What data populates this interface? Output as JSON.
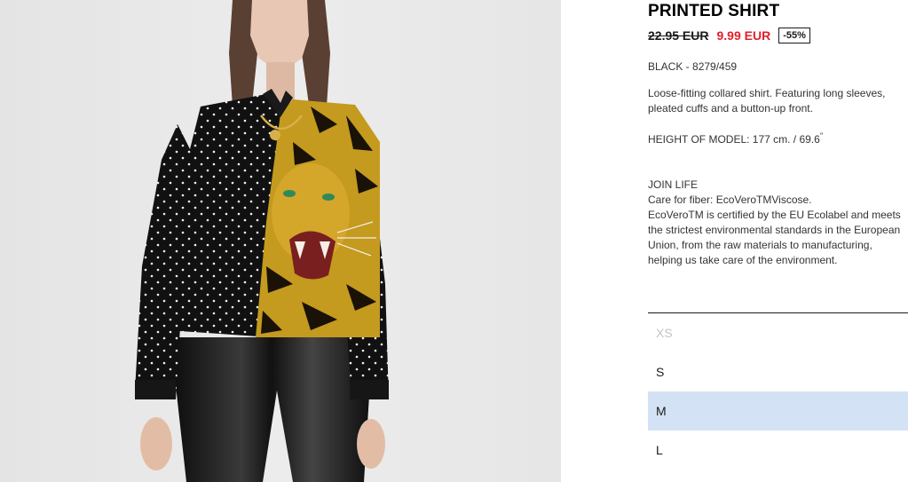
{
  "product": {
    "title": "PRINTED SHIRT",
    "old_price": "22.95 EUR",
    "new_price": "9.99 EUR",
    "discount": "-55%",
    "color_ref": "BLACK - 8279/459",
    "description": "Loose-fitting collared shirt. Featuring long sleeves, pleated cuffs and a button-up front.",
    "model_height": "HEIGHT OF MODEL: 177 cm. / 69.6",
    "model_height_mark": "″",
    "join_life_heading": "JOIN LIFE",
    "join_life_care": "Care for fiber: EcoVeroTMViscose.",
    "join_life_text": "EcoVeroTM is certified by the EU Ecolabel and meets the strictest environmental standards in the European Union, from the raw materials to manufacturing, helping us take care of the environment."
  },
  "sizes": [
    {
      "label": "XS",
      "state": "disabled"
    },
    {
      "label": "S",
      "state": "available"
    },
    {
      "label": "M",
      "state": "selected"
    },
    {
      "label": "L",
      "state": "available"
    }
  ],
  "colors": {
    "sale_red": "#e0202b",
    "selected_size_bg": "#d3e3f5",
    "disabled_text": "#c4c4c4",
    "image_background": "#e9e9e9",
    "shirt_black": "#111111",
    "tiger_ochre": "#c49a1f"
  },
  "image": {
    "subject": "model wearing black polka-dot shirt with tiger print panel and black leather trousers"
  }
}
